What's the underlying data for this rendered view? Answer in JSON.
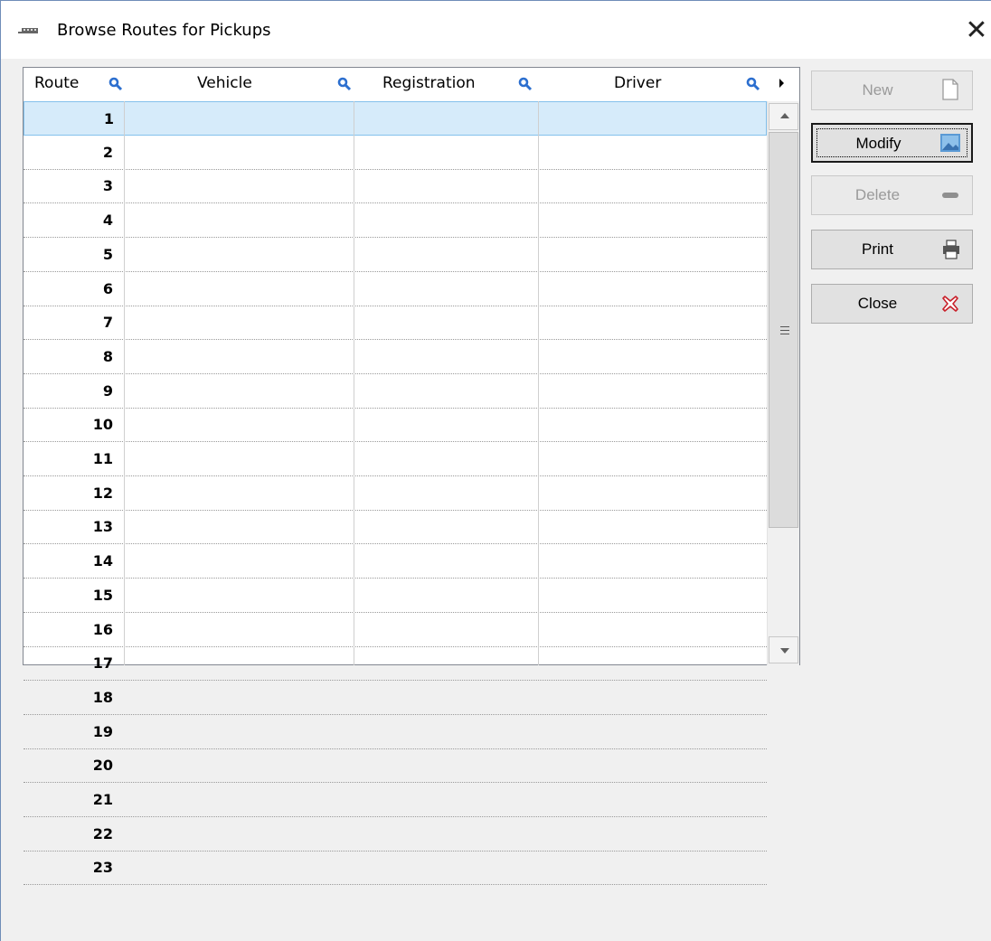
{
  "window": {
    "title": "Browse Routes for Pickups",
    "close_glyph": "✕"
  },
  "grid": {
    "headers": [
      "Route",
      "Vehicle",
      "Registration",
      "Driver"
    ],
    "rows": [
      "1",
      "2",
      "3",
      "4",
      "5",
      "6",
      "7",
      "8",
      "9",
      "10",
      "11",
      "12",
      "13",
      "14",
      "15",
      "16",
      "17",
      "18",
      "19",
      "20",
      "21",
      "22",
      "23"
    ],
    "selected_row": 1
  },
  "buttons": {
    "new": {
      "label": "New",
      "enabled": false,
      "icon": "new-document-icon"
    },
    "modify": {
      "label": "Modify",
      "enabled": true,
      "focused": true,
      "icon": "modify-picture-icon"
    },
    "delete": {
      "label": "Delete",
      "enabled": false,
      "icon": "minus-icon"
    },
    "print": {
      "label": "Print",
      "enabled": true,
      "icon": "printer-icon"
    },
    "close": {
      "label": "Close",
      "enabled": true,
      "icon": "close-cross-icon"
    }
  },
  "colors": {
    "selection": "#d6ebfa",
    "search_icon": "#2c6fcf",
    "close_icon": "#c8202a"
  }
}
